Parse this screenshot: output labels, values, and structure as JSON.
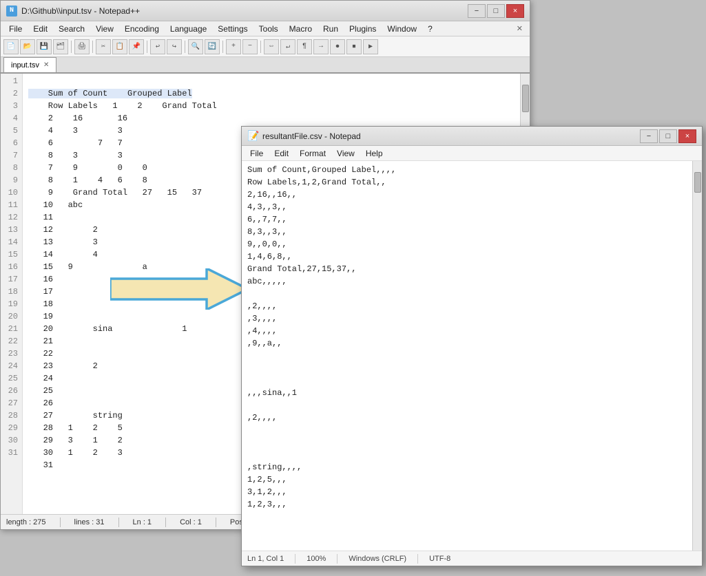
{
  "npp": {
    "title": "D:\\Github\\\\input.tsv - Notepad++",
    "tab_label": "input.tsv",
    "menu": [
      "File",
      "Edit",
      "Search",
      "View",
      "Encoding",
      "Language",
      "Settings",
      "Tools",
      "Macro",
      "Run",
      "Plugins",
      "Window",
      "?"
    ],
    "close_btn": "×",
    "minimize_btn": "−",
    "maximize_btn": "□",
    "statusbar": {
      "length": "length : 275",
      "lines": "lines : 31",
      "ln": "Ln : 1",
      "col": "Col : 1",
      "pos": "Pos : 1"
    },
    "lines": [
      "1 \t Sum of Count\t Grouped Label",
      "2 \t Row Labels\t 1\t 2\t Grand Total",
      "3 \t 2\t 16\t\t 16",
      "4 \t 4\t 3\t\t 3",
      "5 \t 6\t\t 7\t 7",
      "6 \t 8\t 3\t\t 3",
      "7 \t 9\t\t 0\t 0",
      "8 \t 1\t 4\t 6\t 8",
      "9 \t Grand Total\t 27\t 15\t 37",
      "10\t abc",
      "11",
      "12\t\t 2",
      "13\t\t 3",
      "14\t\t 4",
      "15\t 9\t\t\t a",
      "16",
      "17",
      "18",
      "19",
      "20\t\t sina\t\t\t 1",
      "21",
      "22",
      "23\t\t 2",
      "24",
      "25",
      "26",
      "27\t\t string",
      "28\t 1\t 2\t 5",
      "29\t 3\t 1\t 2",
      "30\t 1\t 2\t 3",
      "31"
    ]
  },
  "notepad": {
    "title": "resultantFile.csv - Notepad",
    "title_icon": "📝",
    "menu": [
      "File",
      "Edit",
      "Format",
      "View",
      "Help"
    ],
    "close_btn": "×",
    "minimize_btn": "−",
    "maximize_btn": "□",
    "statusbar": {
      "ln_col": "Ln 1, Col 1",
      "zoom": "100%",
      "line_ending": "Windows (CRLF)",
      "encoding": "UTF-8"
    },
    "content": "Sum of Count,Grouped Label,,,,\nRow Labels,1,2,Grand Total,,\n2,16,,16,,\n4,3,,3,,\n6,,7,7,,\n8,3,,3,,\n9,,0,0,,\n1,4,6,8,,\nGrand Total,27,15,37,,\nabc,,,,,\n\n,2,,,,\n,3,,,,\n,4,,,,\n,9,,a,,\n\n\n\n\n,,,sina,,1\n\n,2,,,,\n\n\n\n,string,,,,\n1,2,5,,,\n3,1,2,,,\n1,2,3,,,"
  },
  "arrow": {
    "label": "arrow"
  }
}
